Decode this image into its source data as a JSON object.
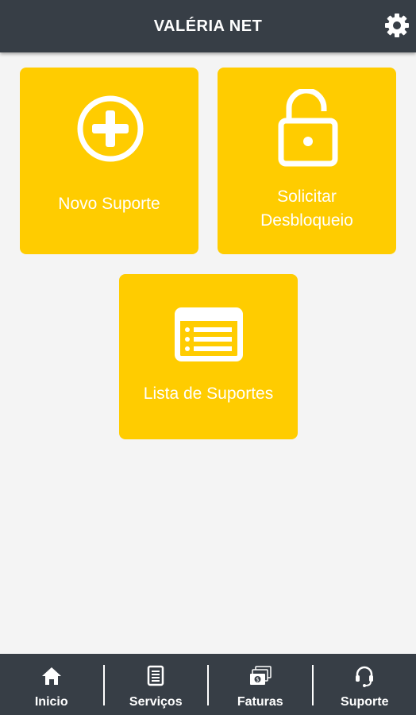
{
  "header": {
    "title": "VALÉRIA NET",
    "settings_icon": "gear-icon"
  },
  "tiles": [
    {
      "label": "Novo Suporte",
      "icon": "plus-circle-icon"
    },
    {
      "label_line1": "Solicitar",
      "label_line2": "Desbloqueio",
      "icon": "unlock-icon"
    },
    {
      "label": "Lista de Suportes",
      "icon": "list-icon"
    }
  ],
  "bottom_nav": [
    {
      "label": "Inicio",
      "icon": "home-icon"
    },
    {
      "label": "Serviços",
      "icon": "document-icon"
    },
    {
      "label": "Faturas",
      "icon": "money-icon"
    },
    {
      "label": "Suporte",
      "icon": "headset-icon"
    }
  ],
  "colors": {
    "bar": "#373e46",
    "tile": "#ffcc00",
    "background": "#f4f4f4"
  }
}
